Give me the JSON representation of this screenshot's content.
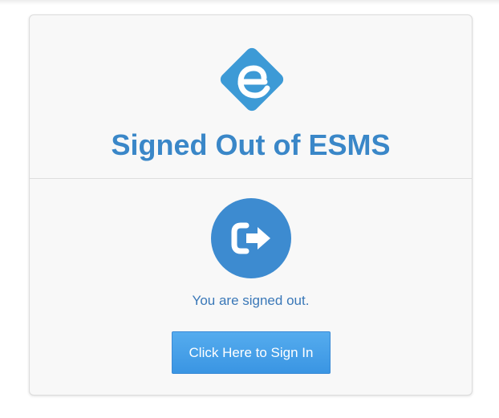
{
  "header": {
    "logo_icon": "esms-e-logo-icon",
    "title": "Signed Out of ESMS"
  },
  "body": {
    "status_icon": "sign-out-icon",
    "status_text": "You are signed out.",
    "signin_label": "Click Here to Sign In"
  },
  "colors": {
    "brand_blue": "#3a87c8",
    "logo_blue": "#3d9ad6",
    "button_blue": "#48a2eb",
    "card_background": "#f8f8f8"
  }
}
